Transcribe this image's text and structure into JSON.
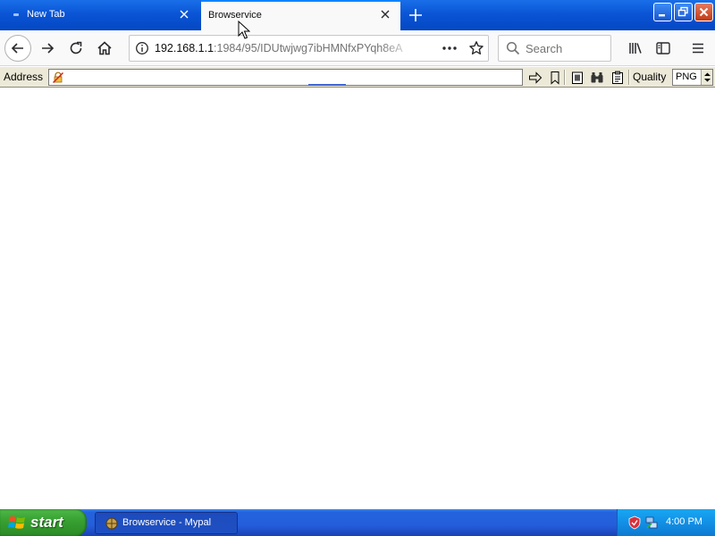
{
  "tabs": [
    {
      "label": "New Tab",
      "active": false
    },
    {
      "label": "Browservice",
      "active": true
    }
  ],
  "navbar": {
    "url_host": "192.168.1.1",
    "url_path": ":1984/95/IDUtwjwg7ibHMNfxPYqh8eA",
    "search_placeholder": "Search"
  },
  "controlbar": {
    "address_label": "Address",
    "address_value": "",
    "quality_label": "Quality",
    "quality_value": "PNG"
  },
  "taskbar": {
    "start_label": "start",
    "task_label": "Browservice - Mypal",
    "clock": "4:00 PM"
  },
  "colors": {
    "tab_active_accent": "#0a84ff",
    "titlebar_blue": "#0a55d6",
    "start_green": "#38a232",
    "toolbar_bg": "#f9f9fa",
    "control_bar_bg": "#ece9d8"
  },
  "icons": [
    "back-arrow-icon",
    "forward-arrow-icon",
    "reload-icon",
    "home-icon",
    "info-icon",
    "more-actions-icon",
    "bookmark-star-icon",
    "search-icon",
    "library-icon",
    "sidebar-icon",
    "hamburger-menu-icon",
    "close-icon",
    "plus-icon",
    "minimize-icon",
    "restore-icon",
    "window-close-icon",
    "insecure-icon",
    "go-arrow-icon",
    "bookmark-icon",
    "clipboard-icon",
    "binoculars-icon",
    "windows-logo-icon",
    "shield-icon",
    "network-icon",
    "mouse-cursor-icon"
  ]
}
